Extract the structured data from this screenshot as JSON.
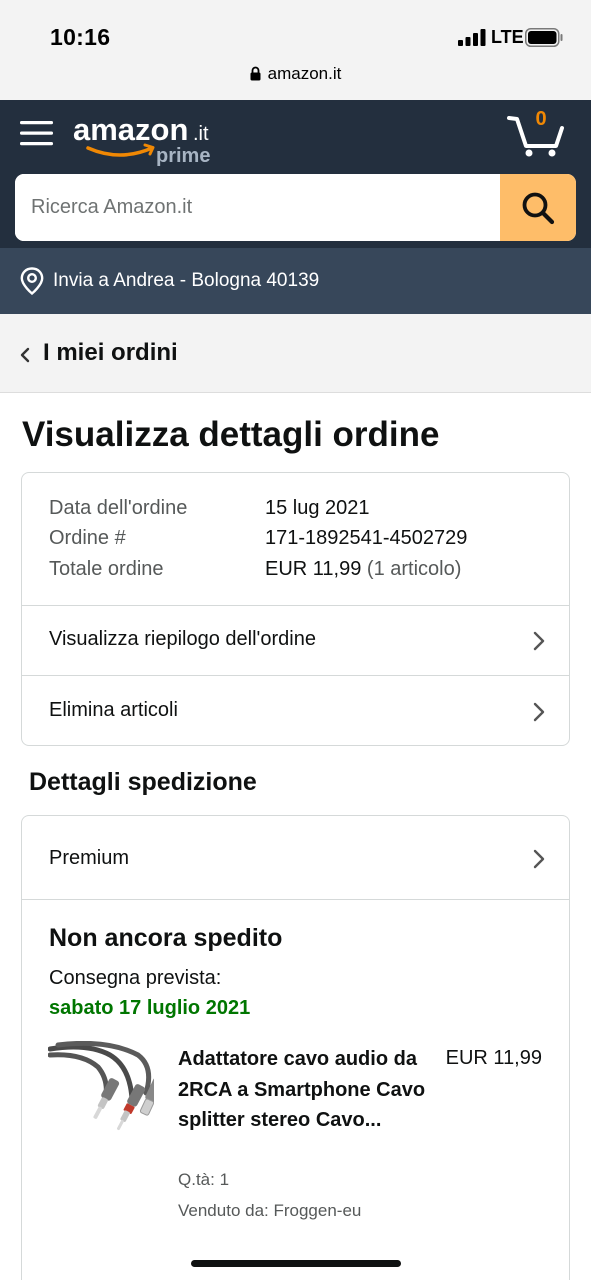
{
  "status_bar": {
    "time": "10:16",
    "network": "LTE",
    "url": "amazon.it"
  },
  "header": {
    "logo_text": "amazon",
    "logo_tld": ".it",
    "logo_sub": "prime",
    "cart_count": "0",
    "search_placeholder": "Ricerca Amazon.it",
    "deliver_to": "Invia a Andrea - Bologna 40139"
  },
  "breadcrumb": {
    "label": "I miei ordini"
  },
  "page": {
    "title": "Visualizza dettagli ordine"
  },
  "order_info": {
    "date_label": "Data dell'ordine",
    "date_value": "15 lug 2021",
    "number_label": "Ordine #",
    "number_value": "171-1892541-4502729",
    "total_label": "Totale ordine",
    "total_value": "EUR 11,99",
    "total_items": "(1 articolo)"
  },
  "order_links": [
    {
      "label": "Visualizza riepilogo dell'ordine"
    },
    {
      "label": "Elimina articoli"
    }
  ],
  "shipment": {
    "section_title": "Dettagli spedizione",
    "shipping_speed": "Premium",
    "status": "Non ancora spedito",
    "delivery_label": "Consegna prevista:",
    "delivery_date": "sabato 17 luglio 2021",
    "delivery_date_color": "#007600"
  },
  "product": {
    "title": "Adattatore cavo audio da 2RCA a Smartphone Cavo splitter stereo Cavo...",
    "price": "EUR 11,99",
    "quantity": "Q.tà: 1",
    "seller": "Venduto da: Froggen-eu"
  },
  "colors": {
    "header_bg": "#232f3e",
    "deliver_bg": "#37475a",
    "search_button": "#febd69",
    "cart_accent": "#f08804"
  }
}
